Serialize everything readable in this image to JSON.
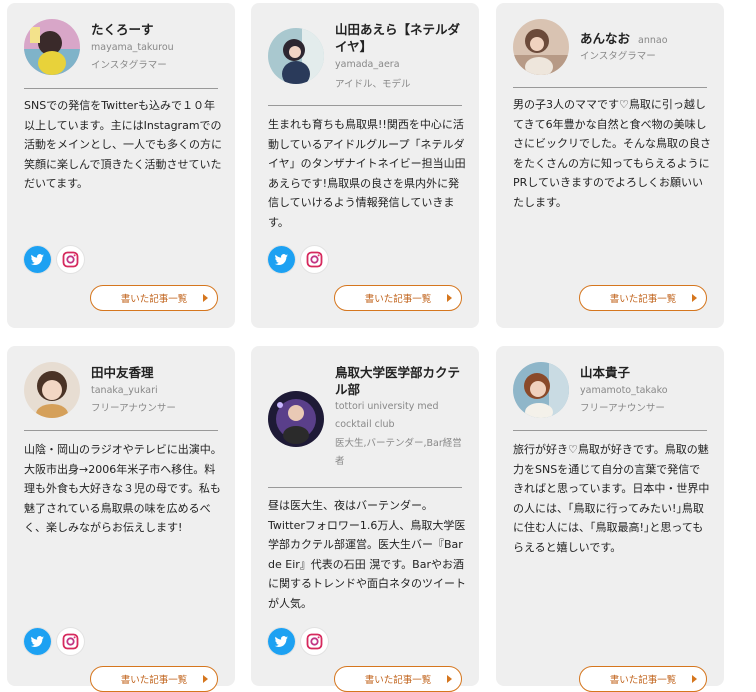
{
  "more_label": "書いた記事一覧",
  "accent_color": "#d5761e",
  "twitter_color": "#1da1f2",
  "profiles": [
    {
      "name": "たくろーす",
      "handle": "mayama_takurou",
      "role": "インスタグラマー",
      "bio": "SNSでの発信をTwitterも込みで１０年以上しています。主にはInstagramでの活動をメインとし、一人でも多くの方に笑顔に楽しんで頂きたく活動させていただいてます。"
    },
    {
      "name": "山田あえら【ネテルダイヤ】",
      "handle": "yamada_aera",
      "role": "アイドル、モデル",
      "bio": "生まれも育ちも鳥取県!!関西を中心に活動しているアイドルグループ「ネテルダイヤ」のタンザナイトネイビー担当山田あえらです!鳥取県の良さを県内外に発信していけるよう情報発信していきます。"
    },
    {
      "name": "あんなお",
      "handle": "annao",
      "role": "インスタグラマー",
      "bio": "男の子3人のママです♡鳥取に引っ越してきて6年豊かな自然と食べ物の美味しさにビックリでした。そんな鳥取の良さをたくさんの方に知ってもらえるようにPRしていきますのでよろしくお願いいたします。"
    },
    {
      "name": "田中友香理",
      "handle": "tanaka_yukari",
      "role": "フリーアナウンサー",
      "bio": "山陰・岡山のラジオやテレビに出演中。大阪市出身→2006年米子市へ移住。料理も外食も大好きな３児の母です。私も魅了されている鳥取県の味を広めるべく、楽しみながらお伝えします!"
    },
    {
      "name": "鳥取大学医学部カクテル部",
      "handle": "tottori university med cocktail club",
      "role": "医大生,バーテンダー,Bar経営者",
      "bio": "昼は医大生、夜はバーテンダー。Twitterフォロワー1.6万人、鳥取大学医学部カクテル部運営。医大生バー『Bar de Eir』代表の石田 滉です。Barやお酒に関するトレンドや面白ネタのツイートが人気。"
    },
    {
      "name": "山本貴子",
      "handle": "yamamoto_takako",
      "role": "フリーアナウンサー",
      "bio": "旅行が好き♡鳥取が好きです。鳥取の魅力をSNSを通じて自分の言葉で発信できればと思っています。日本中・世界中の人には、｢鳥取に行ってみたい!｣鳥取に住む人には、｢鳥取最高!｣と思ってもらえると嬉しいです。"
    }
  ]
}
